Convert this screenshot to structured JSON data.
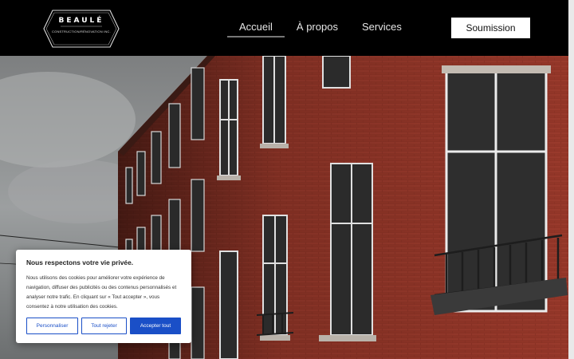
{
  "brand": {
    "name": "BEAULÉ",
    "tagline": "CONSTRUCTION/RÉNOVATION INC."
  },
  "nav": {
    "items": [
      {
        "label": "Accueil",
        "active": true
      },
      {
        "label": "À propos",
        "active": false
      },
      {
        "label": "Services",
        "active": false
      }
    ],
    "cta_label": "Soumission"
  },
  "hero": {
    "image": "red-brick-apartment-building-photo"
  },
  "cookie": {
    "title": "Nous respectons votre vie privée.",
    "text": "Nous utilisons des cookies pour améliorer votre expérience de navigation, diffuser des publicités ou des contenus personnalisés et analyser notre trafic. En cliquant sur « Tout accepter », vous consentez à notre utilisation des cookies.",
    "buttons": {
      "customize": "Personnaliser",
      "reject": "Tout rejeter",
      "accept": "Accepter tout"
    }
  },
  "colors": {
    "header_bg": "#000000",
    "accent_blue": "#1a4fc7",
    "brick": "#8e3428"
  }
}
